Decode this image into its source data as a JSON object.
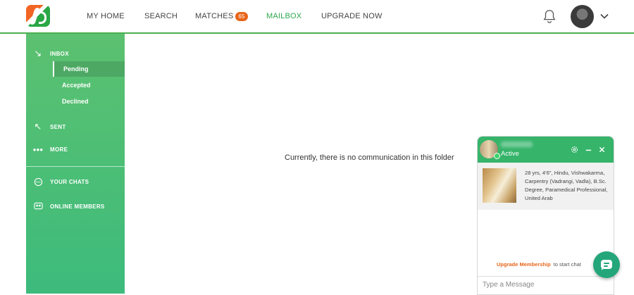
{
  "nav": {
    "home": "MY HOME",
    "search": "SEARCH",
    "matches": "MATCHES",
    "matches_count": "65",
    "mailbox": "MAILBOX",
    "upgrade": "UPGRADE NOW"
  },
  "sidebar": {
    "inbox": "INBOX",
    "inbox_items": [
      "Pending",
      "Accepted",
      "Declined"
    ],
    "sent": "SENT",
    "more": "MORE",
    "your_chats": "YOUR CHATS",
    "online_members": "ONLINE MEMBERS"
  },
  "main": {
    "empty_message": "Currently, there is no communication in this folder"
  },
  "chat": {
    "status": "Active",
    "profile_text": "28 yrs, 4'6\", Hindu, Vishwakarma, Carpentry (Vadrangi, Vadla), B.Sc. Degree, Paramedical Professional, United Arab",
    "upgrade_link": "Upgrade Membership",
    "upgrade_rest": "to start chat",
    "input_placeholder": "Type a Message"
  },
  "colors": {
    "accent": "#2ea84e",
    "sidebar_top": "#5cc170",
    "sidebar_bottom": "#3dbb7c",
    "badge": "#e8651a",
    "fab": "#24a67a"
  },
  "icons": [
    "logo",
    "bell-icon",
    "avatar",
    "chevron-down-icon",
    "arrow-down-right-icon",
    "arrow-up-left-icon",
    "dots-icon",
    "chat-bubble-icon",
    "members-icon",
    "settings-icon",
    "minimize-icon",
    "close-icon",
    "message-fab-icon"
  ]
}
